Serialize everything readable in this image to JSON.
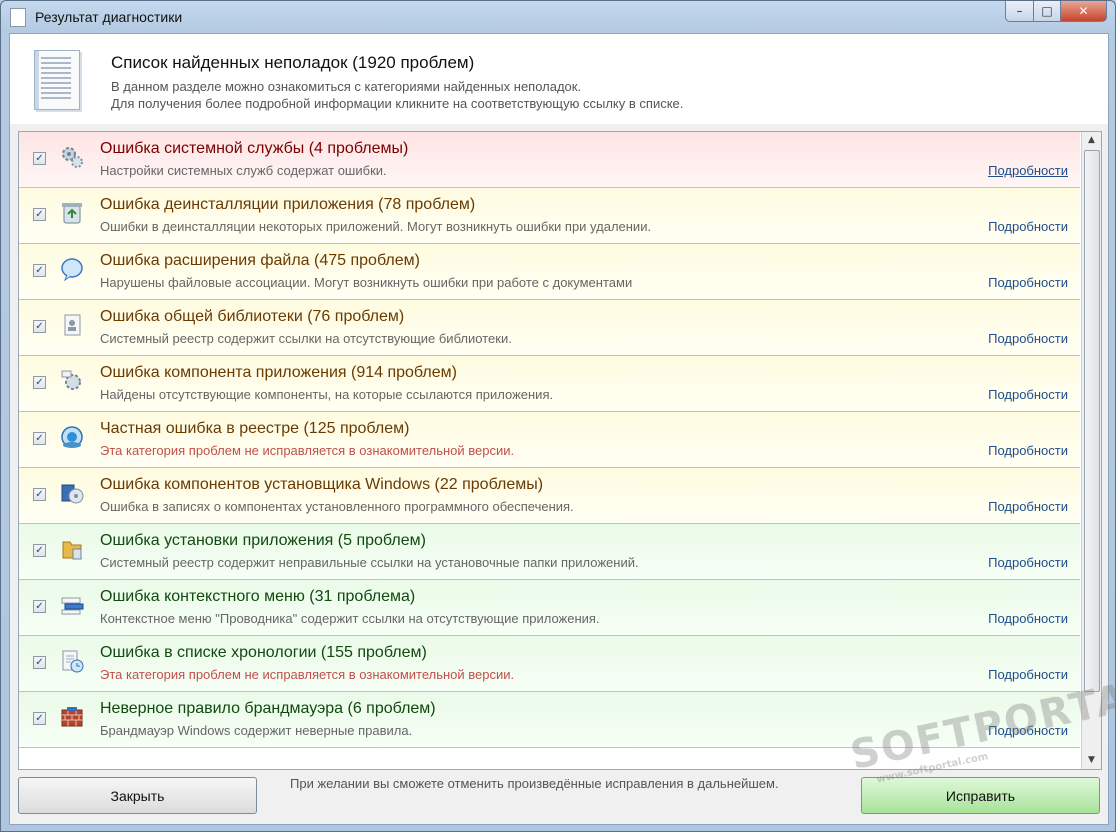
{
  "window": {
    "title": "Результат диагностики",
    "min": "–",
    "max": "□",
    "close": "✕"
  },
  "header": {
    "title": "Список найденных неполадок (1920 проблем)",
    "desc1": "В данном разделе можно ознакомиться с категориями найденных неполадок.",
    "desc2": "Для получения более подробной информации кликните на соответствующую ссылку в списке."
  },
  "items": [
    {
      "title": "Ошибка системной службы (4 проблемы)",
      "desc": "Настройки системных служб содержат ошибки.",
      "more": "Подробности"
    },
    {
      "title": "Ошибка деинсталляции приложения (78 проблем)",
      "desc": "Ошибки в деинсталляции некоторых приложений. Могут возникнуть ошибки при удалении.",
      "more": "Подробности"
    },
    {
      "title": "Ошибка расширения файла (475 проблем)",
      "desc": "Нарушены файловые ассоциации. Могут возникнуть ошибки при работе с документами",
      "more": "Подробности"
    },
    {
      "title": "Ошибка общей библиотеки (76 проблем)",
      "desc": "Системный реестр содержит ссылки на отсутствующие библиотеки.",
      "more": "Подробности"
    },
    {
      "title": "Ошибка компонента приложения (914 проблем)",
      "desc": "Найдены отсутствующие компоненты, на которые ссылаются приложения.",
      "more": "Подробности"
    },
    {
      "title": "Частная ошибка в реестре (125 проблем)",
      "desc": "Эта категория проблем не исправляется в ознакомительной версии.",
      "more": "Подробности"
    },
    {
      "title": "Ошибка компонентов установщика Windows (22 проблемы)",
      "desc": "Ошибка в записях о компонентах установленного программного обеспечения.",
      "more": "Подробности"
    },
    {
      "title": "Ошибка установки приложения (5 проблем)",
      "desc": "Системный реестр содержит неправильные ссылки на установочные папки приложений.",
      "more": "Подробности"
    },
    {
      "title": "Ошибка контекстного меню (31 проблема)",
      "desc": "Контекстное меню \"Проводника\" содержит ссылки на отсутствующие приложения.",
      "more": "Подробности"
    },
    {
      "title": "Ошибка в списке хронологии (155 проблем)",
      "desc": "Эта категория проблем не исправляется в ознакомительной версии.",
      "more": "Подробности"
    },
    {
      "title": "Неверное правило брандмауэра (6 проблем)",
      "desc": "Брандмауэр Windows содержит неверные правила.",
      "more": "Подробности"
    }
  ],
  "footer": {
    "close_label": "Закрыть",
    "note": "При желании вы сможете отменить произведённые исправления в дальнейшем.",
    "fix_label": "Исправить"
  },
  "watermark": {
    "text": "SOFTPORTAL",
    "sub": "www.softportal.com"
  }
}
